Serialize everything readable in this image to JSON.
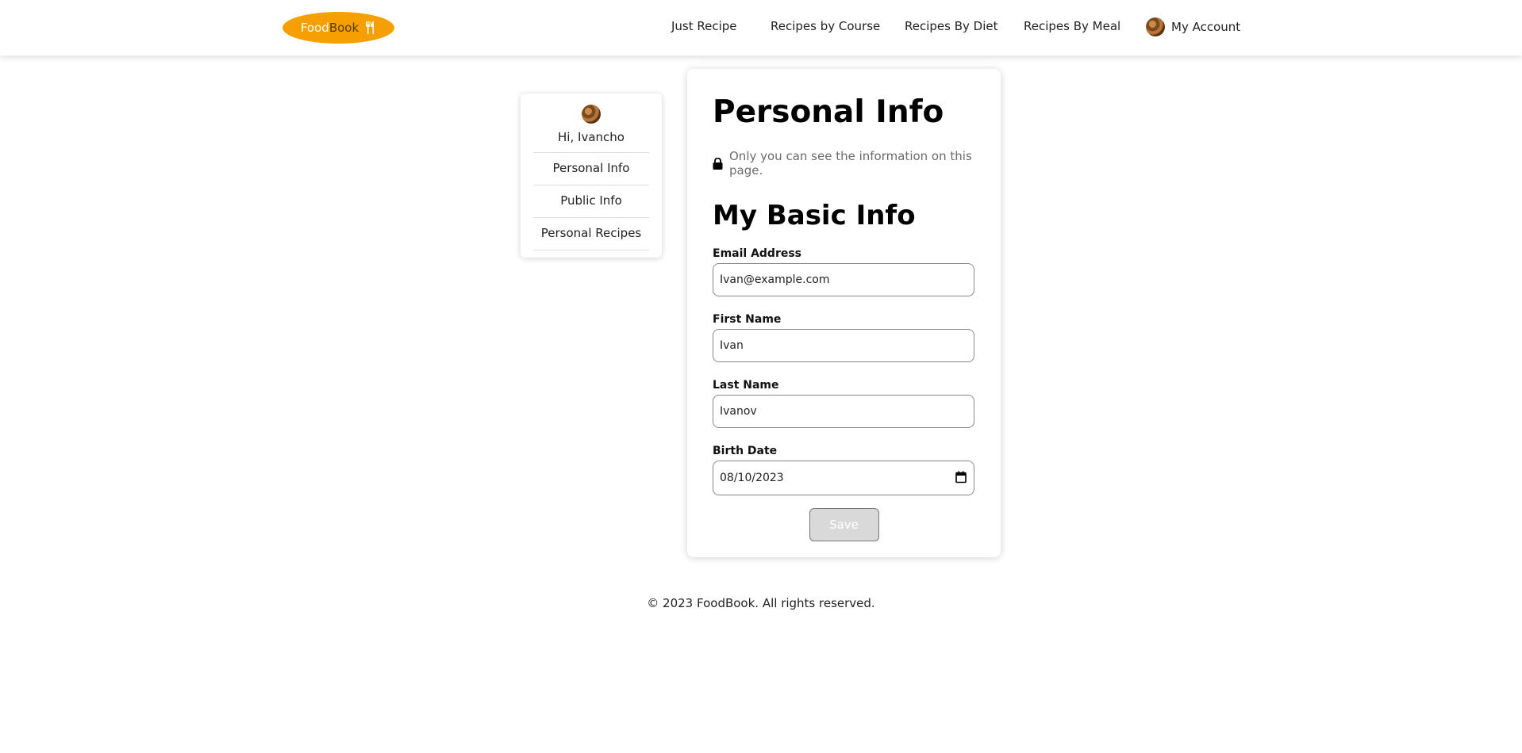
{
  "navbar": {
    "logo_part1": "Food",
    "logo_part2": "Book",
    "logo_icon": "fork-knife-icon",
    "links": [
      "Just Recipe",
      "Recipes by Course",
      "Recipes By Diet",
      "Recipes By Meal"
    ],
    "account_label": "My Account",
    "account_icon": "avatar"
  },
  "sidebar": {
    "greeting": "Hi, Ivancho",
    "items": [
      "Personal Info",
      "Public Info",
      "Personal Recipes"
    ]
  },
  "main": {
    "title": "Personal Info",
    "privacy_note": "Only you can see the information on this page.",
    "privacy_icon": "lock-icon",
    "section_title": "My Basic Info",
    "fields": {
      "email": {
        "label": "Email Address",
        "value": "Ivan@example.com"
      },
      "first_name": {
        "label": "First Name",
        "value": "Ivan"
      },
      "last_name": {
        "label": "Last Name",
        "value": "Ivanov"
      },
      "birth_date": {
        "label": "Birth Date",
        "value": "08/10/2023"
      }
    },
    "save_label": "Save"
  },
  "footer": {
    "text": "© 2023 FoodBook. All rights reserved."
  },
  "colors": {
    "brand": "#f5a000",
    "save_bg": "#d9d9d9",
    "muted": "#6b6b6b"
  }
}
